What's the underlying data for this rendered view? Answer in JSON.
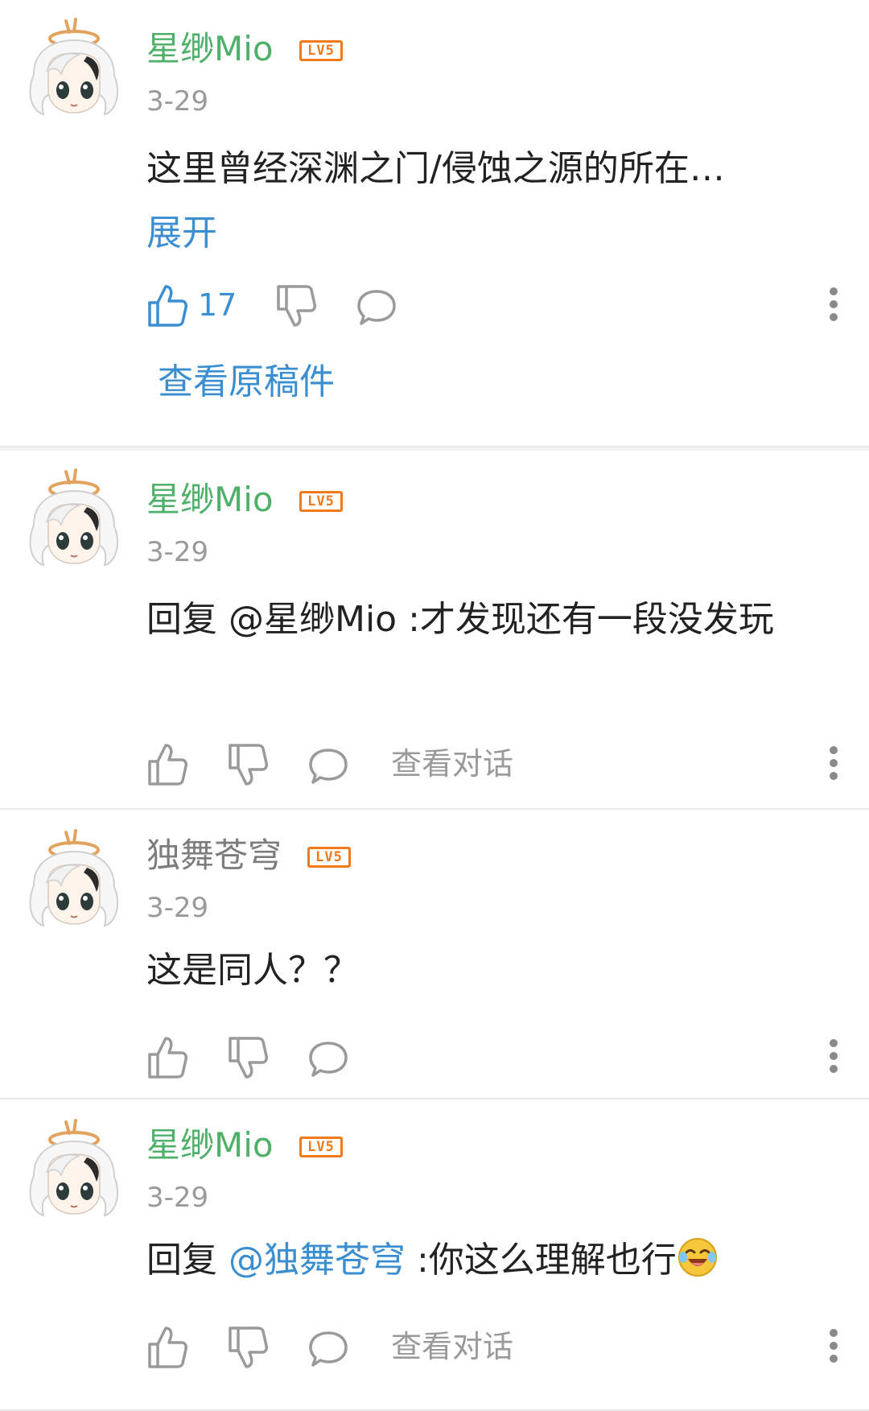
{
  "comments": [
    {
      "username": "星缈Mio",
      "level": "LV5",
      "date": "3-29",
      "text": "这里曾经深渊之门/侵蚀之源的所在…",
      "expand": "展开",
      "likes": "17",
      "view_original": "查看原稿件"
    },
    {
      "username": "星缈Mio",
      "level": "LV5",
      "date": "3-29",
      "reply_prefix": "回复 ",
      "mention": "@星缈Mio",
      "text": " :才发现还有一段没发玩",
      "view_conversation": "查看对话"
    },
    {
      "username": "独舞苍穹",
      "level": "LV5",
      "date": "3-29",
      "text": "这是同人？？"
    },
    {
      "username": "星缈Mio",
      "level": "LV5",
      "date": "3-29",
      "reply_prefix": "回复 ",
      "mention": "@独舞苍穹",
      "text": " :你这么理解也行",
      "emoji": "laughing-crying-emoji",
      "view_conversation": "查看对话"
    }
  ],
  "icons": {
    "like": "thumbs-up-icon",
    "dislike": "thumbs-down-icon",
    "reply": "speech-bubble-icon",
    "more": "vertical-dots-icon"
  },
  "colors": {
    "accent_blue": "#3b8fd0",
    "name_green": "#4fb06a",
    "level_orange": "#f07a1a",
    "muted_gray": "#9a9a9a"
  }
}
